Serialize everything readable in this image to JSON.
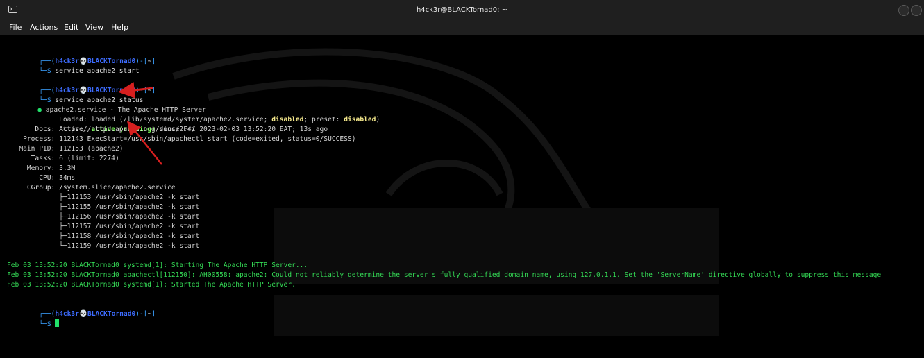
{
  "window": {
    "title": "h4ck3r@BLACKTornad0: ~"
  },
  "menu": [
    "File",
    "Actions",
    "Edit",
    "View",
    "Help"
  ],
  "prompt": {
    "frame_open": "┌──(",
    "user": "h4ck3r",
    "skull": "💀",
    "host": "BLACKTornad0",
    "frame_close": ")-[",
    "dir": "~",
    "frame_end": "]",
    "line2": "└─$ "
  },
  "commands": {
    "c1": "service apache2 start",
    "c2": "service apache2 status"
  },
  "status": {
    "header": "apache2.service - The Apache HTTP Server",
    "loaded_key": "     Loaded: ",
    "loaded_val1": "loaded (/lib/systemd/system/apache2.service; ",
    "loaded_dis1": "disabled",
    "loaded_val2": "; preset: ",
    "loaded_dis2": "disabled",
    "loaded_val3": ")",
    "active_key": "     Active: ",
    "active_val": "active (running)",
    "active_rest": " since Fri 2023-02-03 13:52:20 EAT; 13s ago",
    "docs": "       Docs: https://httpd.apache.org/docs/2.4/",
    "process": "    Process: 112143 ExecStart=/usr/sbin/apachectl start (code=exited, status=0/SUCCESS)",
    "mainpid": "   Main PID: 112153 (apache2)",
    "tasks": "      Tasks: 6 (limit: 2274)",
    "memory": "     Memory: 3.3M",
    "cpu": "        CPU: 34ms",
    "cgroup": "     CGroup: /system.slice/apache2.service",
    "tree": [
      "             ├─112153 /usr/sbin/apache2 -k start",
      "             ├─112155 /usr/sbin/apache2 -k start",
      "             ├─112156 /usr/sbin/apache2 -k start",
      "             ├─112157 /usr/sbin/apache2 -k start",
      "             ├─112158 /usr/sbin/apache2 -k start",
      "             └─112159 /usr/sbin/apache2 -k start"
    ]
  },
  "logs": [
    "Feb 03 13:52:20 BLACKTornad0 systemd[1]: Starting The Apache HTTP Server...",
    "Feb 03 13:52:20 BLACKTornad0 apachectl[112150]: AH00558: apache2: Could not reliably determine the server's fully qualified domain name, using 127.0.1.1. Set the 'ServerName' directive globally to suppress this message",
    "Feb 03 13:52:20 BLACKTornad0 systemd[1]: Started The Apache HTTP Server."
  ],
  "colors": {
    "prompt_frame": "#3aa0ff",
    "prompt_user": "#3d6cff",
    "active_green": "#7cff5a",
    "log_green": "#34d955",
    "annotation_red": "#d61f1f"
  },
  "icons": {
    "terminal": "terminal-icon",
    "status_dot": "status-dot-icon",
    "arrows": "red-annotation-arrow-icon"
  }
}
